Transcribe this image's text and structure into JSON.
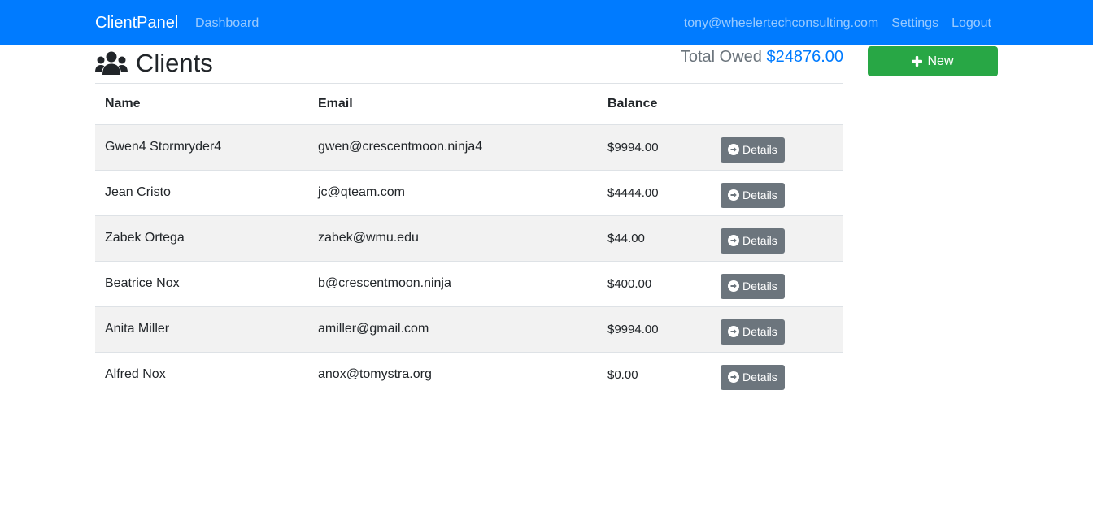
{
  "navbar": {
    "brand": "ClientPanel",
    "dashboard_link": "Dashboard",
    "user_email": "tony@wheelertechconsulting.com",
    "settings_link": "Settings",
    "logout_link": "Logout"
  },
  "page": {
    "title": "Clients",
    "title_icon": "users-icon"
  },
  "summary": {
    "total_owed_label": "Total Owed",
    "total_owed_amount": "$24876.00"
  },
  "new_button": {
    "label": "New",
    "icon": "plus-icon"
  },
  "table": {
    "headers": {
      "name": "Name",
      "email": "Email",
      "balance": "Balance"
    },
    "details_label": "Details",
    "details_icon": "arrow-circle-right-icon",
    "rows": [
      {
        "name": "Gwen4 Stormryder4",
        "email": "gwen@crescentmoon.ninja4",
        "balance": "$9994.00"
      },
      {
        "name": "Jean Cristo",
        "email": "jc@qteam.com",
        "balance": "$4444.00"
      },
      {
        "name": "Zabek Ortega",
        "email": "zabek@wmu.edu",
        "balance": "$44.00"
      },
      {
        "name": "Beatrice Nox",
        "email": "b@crescentmoon.ninja",
        "balance": "$400.00"
      },
      {
        "name": "Anita Miller",
        "email": "amiller@gmail.com",
        "balance": "$9994.00"
      },
      {
        "name": "Alfred Nox",
        "email": "anox@tomystra.org",
        "balance": "$0.00"
      }
    ]
  },
  "colors": {
    "navbar": "#007bff",
    "new_button": "#28a745",
    "details_button": "#6c757d",
    "amount": "#007bff"
  }
}
